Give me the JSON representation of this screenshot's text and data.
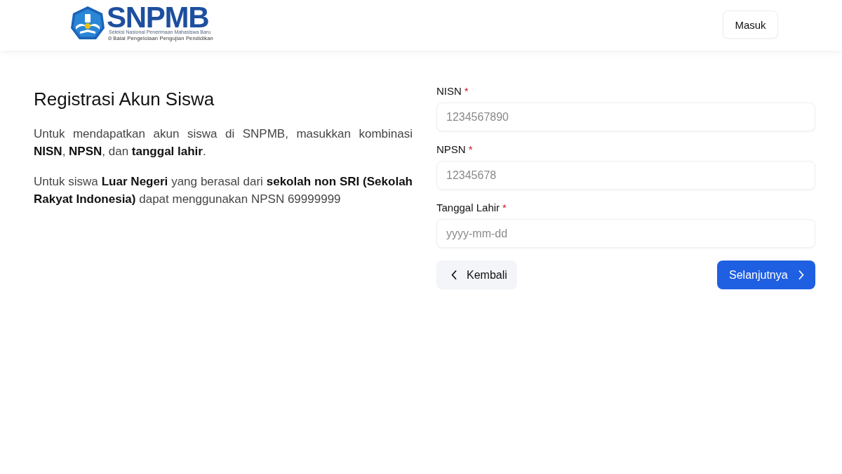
{
  "header": {
    "logo": {
      "title": "SNPMB",
      "tagline": "Seleksi Nasional Penerimaan Mahasiswa Baru",
      "subtitle": "Balai Pengelolaan Pengujian Pendidikan"
    },
    "login_button": "Masuk"
  },
  "intro": {
    "title": "Registrasi Akun Siswa",
    "paragraphs": [
      "Untuk mendapatkan akun siswa di SNPMB, masukkan kombinasi **NISN**, **NPSN**, dan **tanggal lahir**.",
      "Untuk siswa **Luar Negeri** yang berasal dari **sekolah non SRI (Sekolah Rakyat Indonesia)** dapat menggunakan NPSN 69999999"
    ]
  },
  "form": {
    "fields": [
      {
        "label": "NISN",
        "required_mark": "*",
        "placeholder": "1234567890"
      },
      {
        "label": "NPSN",
        "required_mark": "*",
        "placeholder": "12345678"
      },
      {
        "label": "Tanggal Lahir",
        "required_mark": "*",
        "placeholder": "yyyy-mm-dd"
      }
    ],
    "buttons": [
      {
        "kind": "back",
        "label": "Kembali"
      },
      {
        "kind": "next",
        "label": "Selanjutnya"
      }
    ]
  }
}
